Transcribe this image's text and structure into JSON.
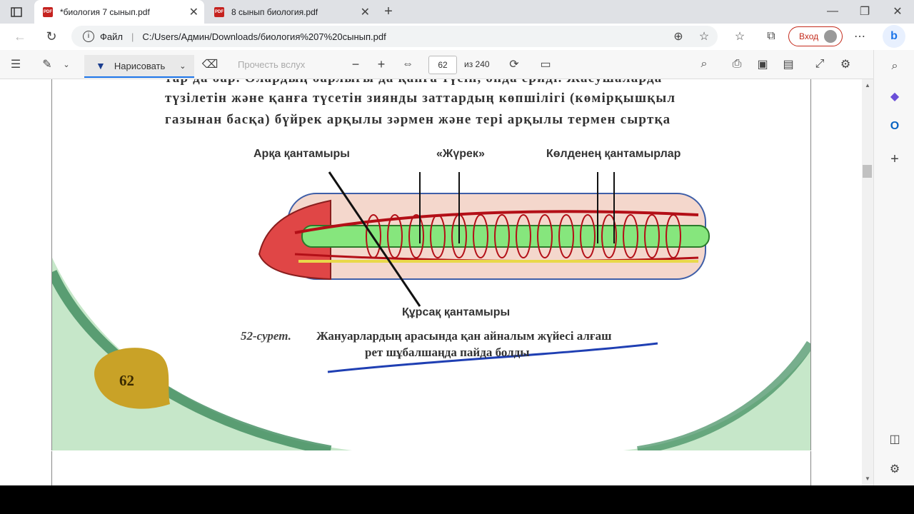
{
  "tabs": [
    {
      "title": "*биология 7 сынып.pdf",
      "active": true
    },
    {
      "title": "8 сынып биология.pdf",
      "active": false
    }
  ],
  "address": {
    "scheme_label": "Файл",
    "url": "C:/Users/Админ/Downloads/биология%207%20сынып.pdf",
    "login_label": "Вход"
  },
  "pdf_toolbar": {
    "draw_label": "Нарисовать",
    "read_aloud_label": "Прочесть вслух",
    "page_number": "62",
    "page_total": "из 240"
  },
  "document": {
    "line1": "тар да бар. Олардың барлығы да қанға түсіп, онда ериді. Жасушаларда",
    "line2": "түзілетін және қанға түсетін зиянды заттардың көпшілігі (көмірқышқыл",
    "line3": "газынан басқа) бүйрек арқылы зәрмен және тері арқылы термен сыртқа",
    "labels": {
      "dorsal": "Арқа қантамыры",
      "heart": "«Жүрек»",
      "transverse": "Көлденең қантамырлар",
      "ventral": "Құрсақ қантамыры"
    },
    "caption_num": "52-сурет.",
    "caption_line1": "Жануарлардың арасында қан айналым жүйесі алғаш",
    "caption_line2": "рет шұбалшаңда пайда болды",
    "page_badge": "62"
  },
  "colors": {
    "annotation_ink": "#1f3fb3",
    "badge": "#c9a227",
    "accent_green": "#3d8b5c"
  }
}
